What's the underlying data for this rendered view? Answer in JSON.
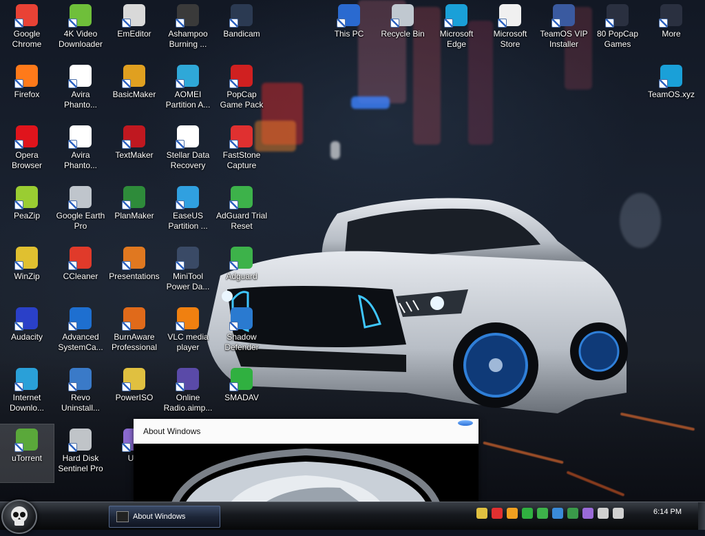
{
  "desktop": {
    "icons": [
      {
        "label": "Google\nChrome",
        "icon": "chrome-icon",
        "color": "#e94235"
      },
      {
        "label": "4K Video\nDownloader",
        "icon": "4k-video-downloader-icon",
        "color": "#6fbf3a"
      },
      {
        "label": "EmEditor",
        "icon": "emeditor-icon",
        "color": "#d9d9d9"
      },
      {
        "label": "Ashampoo\nBurning ...",
        "icon": "ashampoo-burning-icon",
        "color": "#3a3a3a"
      },
      {
        "label": "Bandicam",
        "icon": "bandicam-icon",
        "color": "#2b3a52"
      },
      {
        "label": "Firefox",
        "icon": "firefox-icon",
        "color": "#ff7a1a"
      },
      {
        "label": "Avira\nPhanto...",
        "icon": "avira-phantom-icon",
        "color": "#ffffff"
      },
      {
        "label": "BasicMaker",
        "icon": "basicmaker-icon",
        "color": "#e0a020"
      },
      {
        "label": "AOMEI\nPartition A...",
        "icon": "aomei-partition-icon",
        "color": "#2fa8d8"
      },
      {
        "label": "PopCap\nGame Pack",
        "icon": "popcap-icon",
        "color": "#d02020"
      },
      {
        "label": "Opera\nBrowser",
        "icon": "opera-icon",
        "color": "#e0141c"
      },
      {
        "label": "Avira\nPhanto...",
        "icon": "avira-phantom-icon",
        "color": "#ffffff"
      },
      {
        "label": "TextMaker",
        "icon": "textmaker-icon",
        "color": "#c01820"
      },
      {
        "label": "Stellar Data\nRecovery",
        "icon": "stellar-recovery-icon",
        "color": "#ffffff"
      },
      {
        "label": "FastStone\nCapture",
        "icon": "faststone-capture-icon",
        "color": "#e03030"
      },
      {
        "label": "PeaZip",
        "icon": "peazip-icon",
        "color": "#9acd32"
      },
      {
        "label": "Google Earth\nPro",
        "icon": "google-earth-icon",
        "color": "#bfc5cc"
      },
      {
        "label": "PlanMaker",
        "icon": "planmaker-icon",
        "color": "#2e8b3a"
      },
      {
        "label": "EaseUS\nPartition ...",
        "icon": "easeus-partition-icon",
        "color": "#30a0e0"
      },
      {
        "label": "AdGuard Trial\nReset",
        "icon": "adguard-reset-icon",
        "color": "#3db24a"
      },
      {
        "label": "WinZip",
        "icon": "winzip-icon",
        "color": "#e0c030"
      },
      {
        "label": "CCleaner",
        "icon": "ccleaner-icon",
        "color": "#e03a2a"
      },
      {
        "label": "Presentations",
        "icon": "presentations-icon",
        "color": "#e07820"
      },
      {
        "label": "MiniTool\nPower Da...",
        "icon": "minitool-icon",
        "color": "#3a4a66"
      },
      {
        "label": "Adguard",
        "icon": "adguard-icon",
        "color": "#3db24a"
      },
      {
        "label": "Audacity",
        "icon": "audacity-icon",
        "color": "#2a40c8"
      },
      {
        "label": "Advanced\nSystemCa...",
        "icon": "advanced-systemcare-icon",
        "color": "#1e6fd0"
      },
      {
        "label": "BurnAware\nProfessional",
        "icon": "burnaware-icon",
        "color": "#e06a1a"
      },
      {
        "label": "VLC media\nplayer",
        "icon": "vlc-icon",
        "color": "#f08010"
      },
      {
        "label": "Shadow\nDefender",
        "icon": "shadow-defender-icon",
        "color": "#2a7ad0"
      },
      {
        "label": "Internet\nDownlo...",
        "icon": "internet-download-manager-icon",
        "color": "#2aa0d8"
      },
      {
        "label": "Revo\nUninstall...",
        "icon": "revo-uninstaller-icon",
        "color": "#3a7ac8"
      },
      {
        "label": "PowerISO",
        "icon": "poweriso-icon",
        "color": "#e0c040"
      },
      {
        "label": "Online\nRadio.aimp...",
        "icon": "online-radio-icon",
        "color": "#5a4aa8"
      },
      {
        "label": "SMADAV",
        "icon": "smadav-icon",
        "color": "#30b040"
      },
      {
        "label": "uTorrent",
        "icon": "utorrent-icon",
        "color": "#5aa83a"
      },
      {
        "label": "Hard Disk\nSentinel Pro",
        "icon": "hard-disk-sentinel-icon",
        "color": "#c0c4c8"
      },
      {
        "label": "Ultr",
        "icon": "ultraiso-icon",
        "color": "#8a6ad0"
      },
      {
        "label": "This PC",
        "icon": "this-pc-icon",
        "color": "#2a6ad0"
      },
      {
        "label": "Recycle Bin",
        "icon": "recycle-bin-icon",
        "color": "#c0c8d0"
      },
      {
        "label": "Microsoft\nEdge",
        "icon": "edge-icon",
        "color": "#1aa0d8"
      },
      {
        "label": "Microsoft\nStore",
        "icon": "microsoft-store-icon",
        "color": "#f0f0f0"
      },
      {
        "label": "TeamOS VIP\nInstaller",
        "icon": "teamos-installer-icon",
        "color": "#3a5aa0"
      },
      {
        "label": "80 PopCap\nGames",
        "icon": "popcap-games-folder-icon",
        "color": "#2a3040"
      },
      {
        "label": "More",
        "icon": "more-folder-icon",
        "color": "#2a3040"
      },
      {
        "label": "TeamOS.xyz",
        "icon": "teamos-edge-icon",
        "color": "#1aa0d8"
      }
    ]
  },
  "about_window": {
    "title": "About Windows"
  },
  "taskbar": {
    "active_task": "About Windows",
    "clock": "6:14 PM",
    "tray_icons": [
      {
        "icon": "poweriso-tray-icon",
        "color": "#e0c040"
      },
      {
        "icon": "avira-tray-icon",
        "color": "#e03030"
      },
      {
        "icon": "faststone-tray-icon",
        "color": "#f0a020"
      },
      {
        "icon": "smadav-tray-icon",
        "color": "#30b040"
      },
      {
        "icon": "adguard-tray-icon",
        "color": "#3db24a"
      },
      {
        "icon": "network-drive-tray-icon",
        "color": "#3a8ad8"
      },
      {
        "icon": "google-earth-tray-icon",
        "color": "#3a9a4a"
      },
      {
        "icon": "feather-tray-icon",
        "color": "#9a6ad8"
      },
      {
        "icon": "network-tray-icon",
        "color": "#d0d0d0"
      },
      {
        "icon": "volume-tray-icon",
        "color": "#d0d0d0"
      }
    ]
  },
  "colors": {
    "taskbar_button_accent": "#55698d",
    "road_line": "#c8602c"
  }
}
